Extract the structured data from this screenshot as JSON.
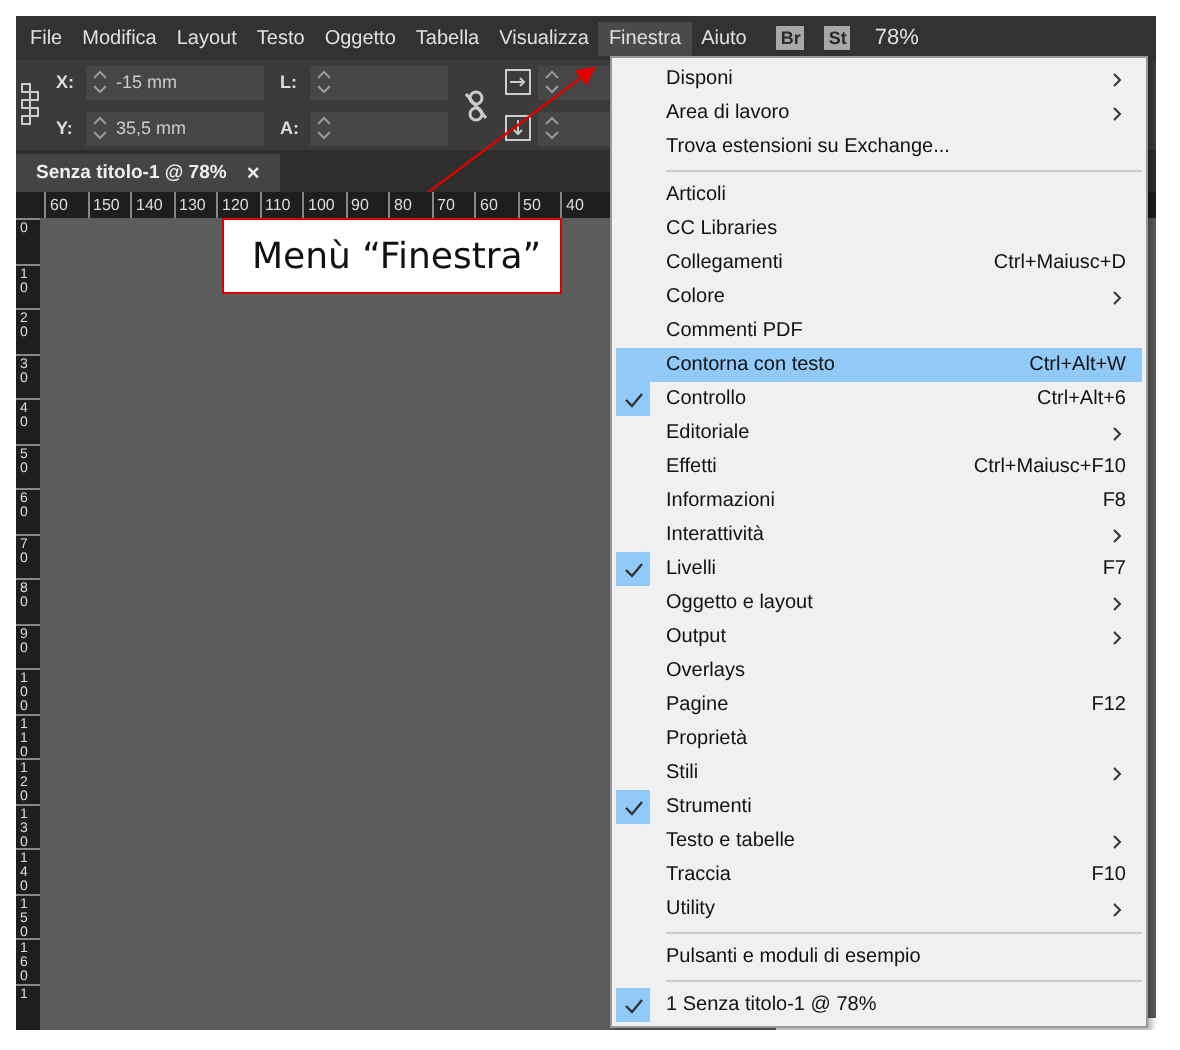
{
  "menubar": [
    {
      "label": "File",
      "selected": false
    },
    {
      "label": "Modifica",
      "selected": false
    },
    {
      "label": "Layout",
      "selected": false
    },
    {
      "label": "Testo",
      "selected": false
    },
    {
      "label": "Oggetto",
      "selected": false
    },
    {
      "label": "Tabella",
      "selected": false
    },
    {
      "label": "Visualizza",
      "selected": false
    },
    {
      "label": "Finestra",
      "selected": true
    },
    {
      "label": "Aiuto",
      "selected": false
    }
  ],
  "app_badges": [
    "Br",
    "St"
  ],
  "zoom": "78%",
  "control_panel": {
    "x_label": "X:",
    "x_value": "-15 mm",
    "y_label": "Y:",
    "y_value": "35,5 mm",
    "w_label": "L:",
    "h_label": "A:"
  },
  "document_tab": {
    "title": "Senza titolo-1 @ 78%",
    "close": "×"
  },
  "ruler_h": [
    "60",
    "150",
    "140",
    "130",
    "120",
    "110",
    "100",
    "90",
    "80",
    "70",
    "60",
    "50",
    "40"
  ],
  "ruler_v": [
    "0",
    "10",
    "20",
    "30",
    "40",
    "50",
    "60",
    "70",
    "80",
    "90",
    "100",
    "110",
    "120",
    "130",
    "140",
    "150",
    "160",
    "1"
  ],
  "callout": "Menù “Finestra”",
  "menu": [
    {
      "kind": "item",
      "label": "Disponi",
      "submenu": true,
      "checked": false,
      "selected": false
    },
    {
      "kind": "item",
      "label": "Area di lavoro",
      "submenu": true,
      "checked": false,
      "selected": false
    },
    {
      "kind": "item",
      "label": "Trova estensioni su Exchange...",
      "submenu": false,
      "checked": false,
      "selected": false
    },
    {
      "kind": "separator"
    },
    {
      "kind": "item",
      "label": "Articoli",
      "submenu": false,
      "checked": false,
      "selected": false
    },
    {
      "kind": "item",
      "label": "CC Libraries",
      "submenu": false,
      "checked": false,
      "selected": false
    },
    {
      "kind": "item",
      "label": "Collegamenti",
      "shortcut": "Ctrl+Maiusc+D",
      "submenu": false,
      "checked": false,
      "selected": false
    },
    {
      "kind": "item",
      "label": "Colore",
      "submenu": true,
      "checked": false,
      "selected": false
    },
    {
      "kind": "item",
      "label": "Commenti PDF",
      "submenu": false,
      "checked": false,
      "selected": false
    },
    {
      "kind": "item",
      "label": "Contorna con testo",
      "shortcut": "Ctrl+Alt+W",
      "submenu": false,
      "checked": false,
      "selected": true
    },
    {
      "kind": "item",
      "label": "Controllo",
      "shortcut": "Ctrl+Alt+6",
      "submenu": false,
      "checked": true,
      "selected": false
    },
    {
      "kind": "item",
      "label": "Editoriale",
      "submenu": true,
      "checked": false,
      "selected": false
    },
    {
      "kind": "item",
      "label": "Effetti",
      "shortcut": "Ctrl+Maiusc+F10",
      "submenu": false,
      "checked": false,
      "selected": false
    },
    {
      "kind": "item",
      "label": "Informazioni",
      "shortcut": "F8",
      "submenu": false,
      "checked": false,
      "selected": false
    },
    {
      "kind": "item",
      "label": "Interattività",
      "submenu": true,
      "checked": false,
      "selected": false
    },
    {
      "kind": "item",
      "label": "Livelli",
      "shortcut": "F7",
      "submenu": false,
      "checked": true,
      "selected": false
    },
    {
      "kind": "item",
      "label": "Oggetto e layout",
      "submenu": true,
      "checked": false,
      "selected": false
    },
    {
      "kind": "item",
      "label": "Output",
      "submenu": true,
      "checked": false,
      "selected": false
    },
    {
      "kind": "item",
      "label": "Overlays",
      "submenu": false,
      "checked": false,
      "selected": false
    },
    {
      "kind": "item",
      "label": "Pagine",
      "shortcut": "F12",
      "submenu": false,
      "checked": false,
      "selected": false
    },
    {
      "kind": "item",
      "label": "Proprietà",
      "submenu": false,
      "checked": false,
      "selected": false
    },
    {
      "kind": "item",
      "label": "Stili",
      "submenu": true,
      "checked": false,
      "selected": false
    },
    {
      "kind": "item",
      "label": "Strumenti",
      "submenu": false,
      "checked": true,
      "selected": false
    },
    {
      "kind": "item",
      "label": "Testo e tabelle",
      "submenu": true,
      "checked": false,
      "selected": false
    },
    {
      "kind": "item",
      "label": "Traccia",
      "shortcut": "F10",
      "submenu": false,
      "checked": false,
      "selected": false
    },
    {
      "kind": "item",
      "label": "Utility",
      "submenu": true,
      "checked": false,
      "selected": false
    },
    {
      "kind": "separator"
    },
    {
      "kind": "item",
      "label": "Pulsanti e moduli di esempio",
      "submenu": false,
      "checked": false,
      "selected": false
    },
    {
      "kind": "separator"
    },
    {
      "kind": "item",
      "label": "1 Senza titolo-1 @ 78%",
      "submenu": false,
      "checked": true,
      "selected": false
    }
  ]
}
